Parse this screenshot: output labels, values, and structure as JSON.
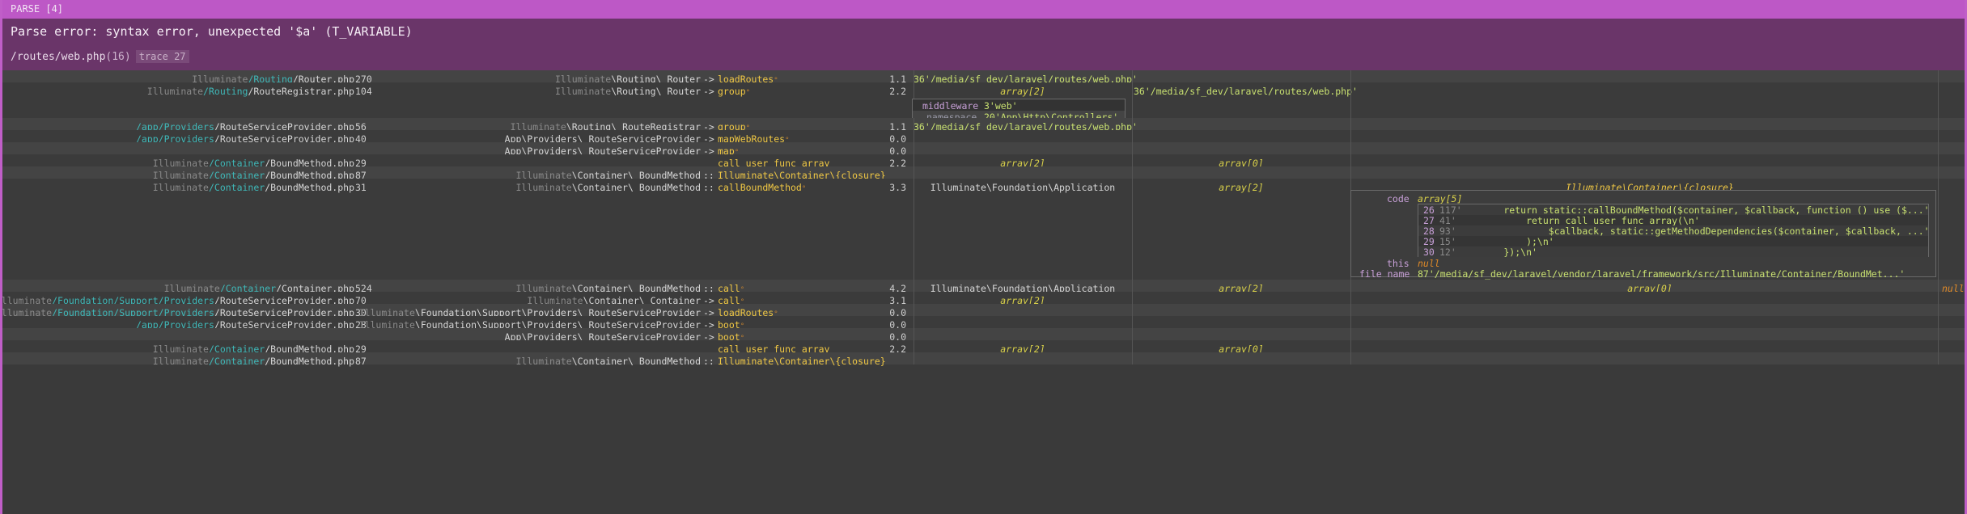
{
  "header": {
    "label": "PARSE [4]",
    "message": "Parse error: syntax error, unexpected '$a' (T_VARIABLE)",
    "file": "/routes/web.php",
    "line": "(16)",
    "trace": "trace 27"
  },
  "frames": [
    {
      "file_prefix": "Illuminate",
      "file_mid": "/Routing",
      "file_name": "/Router.php",
      "line": "270",
      "cls_prefix": "Illuminate",
      "cls_rest": "\\Routing\\ Router",
      "op": "->",
      "func": "loadRoutes",
      "star": true,
      "time": "1.1",
      "arg1": "36'/media/sf_dev/laravel/routes/web.php'"
    },
    {
      "file_prefix": "Illuminate",
      "file_mid": "/Routing",
      "file_name": "/RouteRegistrar.php",
      "line": "104",
      "cls_prefix": "Illuminate",
      "cls_rest": "\\Routing\\ Router",
      "op": "->",
      "func": "group",
      "star": true,
      "time": "2.2",
      "arg1": "array[2]",
      "arg2": "36'/media/sf_dev/laravel/routes/web.php'"
    },
    {
      "file_prefix": "",
      "file_mid": "/app/Providers",
      "file_name": "/RouteServiceProvider.php",
      "line": "56",
      "cls_prefix": "Illuminate",
      "cls_rest": "\\Routing\\ RouteRegistrar",
      "op": "->",
      "func": "group",
      "star": true,
      "time": "1.1",
      "arg1": "36'/media/sf_dev/laravel/routes/web.php'"
    },
    {
      "file_prefix": "",
      "file_mid": "/app/Providers",
      "file_name": "/RouteServiceProvider.php",
      "line": "40",
      "cls_prefix": "",
      "cls_rest": "App\\Providers\\ RouteServiceProvider",
      "op": "->",
      "func": "mapWebRoutes",
      "star": true,
      "time": "0.0"
    },
    {
      "file_prefix": "",
      "file_mid": "",
      "file_name": "",
      "line": "",
      "cls_prefix": "",
      "cls_rest": "App\\Providers\\ RouteServiceProvider",
      "op": "->",
      "func": "map",
      "star": true,
      "time": "0.0"
    },
    {
      "file_prefix": "Illuminate",
      "file_mid": "/Container",
      "file_name": "/BoundMethod.php",
      "line": "29",
      "cls_prefix": "",
      "cls_rest": "",
      "op": "",
      "func": "call_user_func_array",
      "star": false,
      "time": "2.2",
      "arg1": "array[2]",
      "arg2": "array[0]"
    },
    {
      "file_prefix": "Illuminate",
      "file_mid": "/Container",
      "file_name": "/BoundMethod.php",
      "line": "87",
      "cls_prefix": "Illuminate",
      "cls_rest": "\\Container\\ BoundMethod",
      "op": "::",
      "func": "Illuminate\\Container\\{closure}",
      "star": false,
      "time": ""
    },
    {
      "file_prefix": "Illuminate",
      "file_mid": "/Container",
      "file_name": "/BoundMethod.php",
      "line": "31",
      "cls_prefix": "Illuminate",
      "cls_rest": "\\Container\\ BoundMethod",
      "op": "::",
      "func": "callBoundMethod",
      "star": true,
      "time": "3.3",
      "arg1": "Illuminate\\Foundation\\Application",
      "arg2": "array[2]",
      "arg3": "Illuminate\\Container\\{closure}"
    },
    {
      "file_prefix": "Illuminate",
      "file_mid": "/Container",
      "file_name": "/Container.php",
      "line": "524",
      "cls_prefix": "Illuminate",
      "cls_rest": "\\Container\\ BoundMethod",
      "op": "::",
      "func": "call",
      "star": true,
      "time": "4.2",
      "arg1": "Illuminate\\Foundation\\Application",
      "arg2": "array[2]",
      "arg3": "array[0]",
      "arg4": "null"
    },
    {
      "file_prefix": "Illuminate",
      "file_mid": "/Foundation/Support/Providers",
      "file_name": "/RouteServiceProvider.php",
      "line": "70",
      "cls_prefix": "Illuminate",
      "cls_rest": "\\Container\\ Container",
      "op": "->",
      "func": "call",
      "star": true,
      "time": "3.1",
      "arg1": "array[2]"
    },
    {
      "file_prefix": "Illuminate",
      "file_mid": "/Foundation/Support/Providers",
      "file_name": "/RouteServiceProvider.php",
      "line": "30",
      "cls_prefix": "Illuminate",
      "cls_rest": "\\Foundation\\Support\\Providers\\ RouteServiceProvider",
      "op": "->",
      "func": "loadRoutes",
      "star": true,
      "time": "0.0"
    },
    {
      "file_prefix": "",
      "file_mid": "/app/Providers",
      "file_name": "/RouteServiceProvider.php",
      "line": "28",
      "cls_prefix": "Illuminate",
      "cls_rest": "\\Foundation\\Support\\Providers\\ RouteServiceProvider",
      "op": "->",
      "func": "boot",
      "star": true,
      "time": "0.0"
    },
    {
      "file_prefix": "",
      "file_mid": "",
      "file_name": "",
      "line": "",
      "cls_prefix": "",
      "cls_rest": "App\\Providers\\ RouteServiceProvider",
      "op": "->",
      "func": "boot",
      "star": true,
      "time": "0.0"
    },
    {
      "file_prefix": "Illuminate",
      "file_mid": "/Container",
      "file_name": "/BoundMethod.php",
      "line": "29",
      "cls_prefix": "",
      "cls_rest": "",
      "op": "",
      "func": "call_user_func_array",
      "star": false,
      "time": "2.2",
      "arg1": "array[2]",
      "arg2": "array[0]"
    },
    {
      "file_prefix": "Illuminate",
      "file_mid": "/Container",
      "file_name": "/BoundMethod.php",
      "line": "87",
      "cls_prefix": "Illuminate",
      "cls_rest": "\\Container\\ BoundMethod",
      "op": "::",
      "func": "Illuminate\\Container\\{closure}",
      "star": false,
      "time": ""
    }
  ],
  "group_args": {
    "middleware_key": "middleware",
    "middleware_val": "3'web'",
    "namespace_key": "namespace",
    "namespace_val": "20'App\\Http\\Controllers'"
  },
  "closure_detail": {
    "code_key": "code",
    "code_val": "array[5]",
    "lines": [
      {
        "n": "26",
        "len": "117'",
        "text": "        return static::callBoundMethod($container, $callback, function () use ($...'"
      },
      {
        "n": "27",
        "len": "41'",
        "text": "            return call_user_func_array(\\n'"
      },
      {
        "n": "28",
        "len": "93'",
        "text": "                $callback, static::getMethodDependencies($container, $callback, ...'"
      },
      {
        "n": "29",
        "len": "15'",
        "text": "            );\\n'"
      },
      {
        "n": "30",
        "len": "12'",
        "text": "        });\\n'"
      }
    ],
    "this_key": "this",
    "this_val": "null",
    "file_key": "file name",
    "file_val": "87'/media/sf_dev/laravel/vendor/laravel/framework/src/Illuminate/Container/BoundMet...'"
  }
}
